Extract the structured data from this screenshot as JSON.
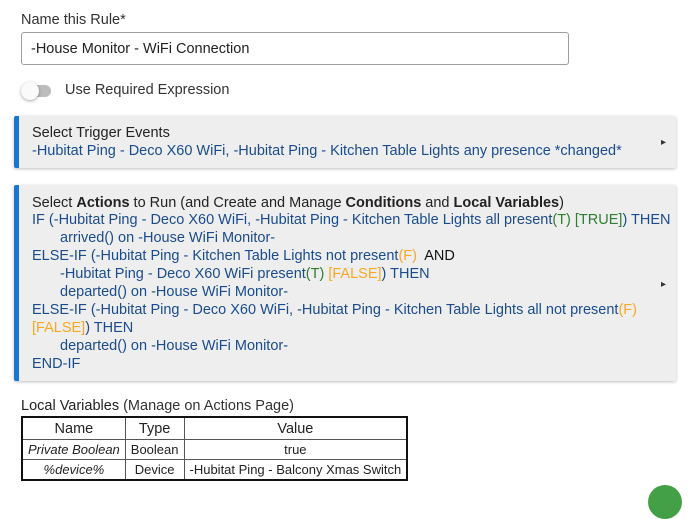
{
  "rule_name": {
    "label": "Name this Rule*",
    "value": "-House Monitor - WiFi Connection"
  },
  "required_expression": {
    "label": "Use Required Expression",
    "enabled": false
  },
  "trigger_section": {
    "title": "Select Trigger Events",
    "summary": "-Hubitat Ping - Deco X60 WiFi, -Hubitat Ping - Kitchen Table Lights any presence *changed*",
    "arrow": "▸"
  },
  "actions_section": {
    "title_parts": [
      "Select ",
      "Actions",
      " to Run (and Create and Manage ",
      "Conditions",
      " and ",
      "Local Variables",
      ")"
    ],
    "arrow": "▸",
    "lines": {
      "l1": {
        "a": "IF (-Hubitat Ping - Deco X60 WiFi, -Hubitat Ping - Kitchen Table Lights all present",
        "b": "(T)",
        "c": " ",
        "d": "[TRUE]",
        "e": ") THEN"
      },
      "l2": "arrived() on -House WiFi Monitor-",
      "l3": {
        "a": "ELSE-IF (-Hubitat Ping - Kitchen Table Lights not present",
        "b": "(F)",
        "c": "  AND"
      },
      "l4": {
        "a": "-Hubitat Ping - Deco X60 WiFi present",
        "b": "(T)",
        "c": " ",
        "d": "[FALSE]",
        "e": ") THEN"
      },
      "l5": "departed() on -House WiFi Monitor-",
      "l6": {
        "a": "ELSE-IF (-Hubitat Ping - Deco X60 WiFi, -Hubitat Ping - Kitchen Table Lights all not present",
        "b": "(F)"
      },
      "l7": {
        "a": "[FALSE]",
        "b": ") THEN"
      },
      "l8": "departed() on -House WiFi Monitor-",
      "l9": "END-IF"
    }
  },
  "local_variables": {
    "title": "Local Variables",
    "manage_note": " (Manage on Actions Page)",
    "headers": [
      "Name",
      "Type",
      "Value"
    ],
    "rows": [
      [
        "Private Boolean",
        "Boolean",
        "true"
      ],
      [
        "%device%",
        "Device",
        "-Hubitat Ping - Balcony Xmas Switch"
      ]
    ]
  },
  "colors": {
    "accent": "#1976d2",
    "statement_text": "#1a4b8c",
    "true_green": "#2e7d32",
    "false_amber": "#f9a825",
    "fab_green": "#43a047"
  }
}
